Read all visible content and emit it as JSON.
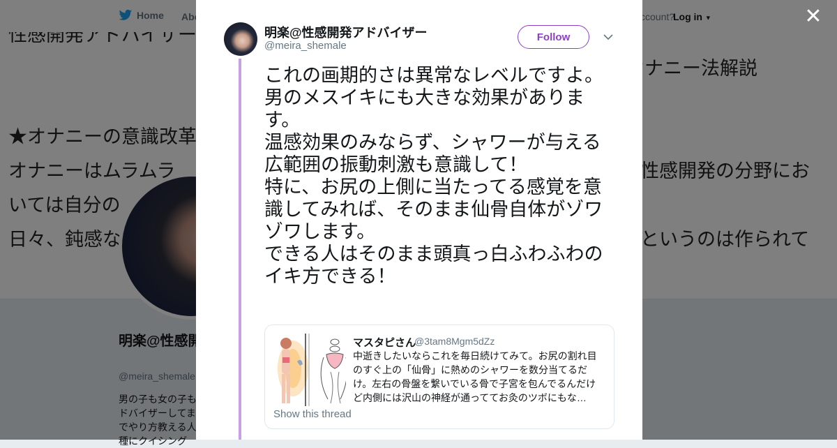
{
  "nav": {
    "home_label": "Home",
    "about_label": "Abo",
    "account_prompt": "ccount?",
    "login_label": "Log in"
  },
  "banner": {
    "line1": "性感開発アドバイザー",
    "line2": "オナニー法解説",
    "line3": "★オナニーの意識改革",
    "line4": "オナニーはムラムラ",
    "line5": "性感開発の分野にお",
    "line6": "いては自分の",
    "line7": "日々、鈍感な",
    "line8": "というのは作られて"
  },
  "profile": {
    "name": "明楽@性感開発アドバイザー",
    "handle": "@meira_shemale",
    "bio": "男の子も女の子もドバイザーしてまでやり方教える人種にクイシング"
  },
  "tweet": {
    "author_name": "明楽@性感開発アドバイザー",
    "author_handle": "@meira_shemale",
    "follow_label": "Follow",
    "text": "これの画期的さは異常なレベルですよ。\n男のメスイキにも大きな効果があります。\n温感効果のみならず、シャワーが与える広範囲の振動刺激も意識して！\n特に、お尻の上側に当たってる感覚を意識してみれば、そのまま仙骨自体がゾワゾワします。\nできる人はそのまま頭真っ白ふわふわのイキ方できる！"
  },
  "quote": {
    "name": "マスタピさん",
    "handle": "@3tam8Mgm5dZz",
    "text": "中逝きしたいならこれを毎日続けてみて。お尻の割れ目のすぐ上の「仙骨」に熱めのシャワーを数分当てるだけ。左右の骨盤を繋いでいる骨で子宮を包んでるんだけど内側には沢山の神経が通っててお灸のツボにもな…",
    "show_thread_label": "Show this thread"
  },
  "colors": {
    "accent": "#8e3fc9",
    "thread_line": "#c9a0e6",
    "secondary_text": "#657786"
  },
  "icons": [
    "twitter-bird-icon",
    "caret-down-icon",
    "close-icon",
    "chevron-down-icon"
  ]
}
